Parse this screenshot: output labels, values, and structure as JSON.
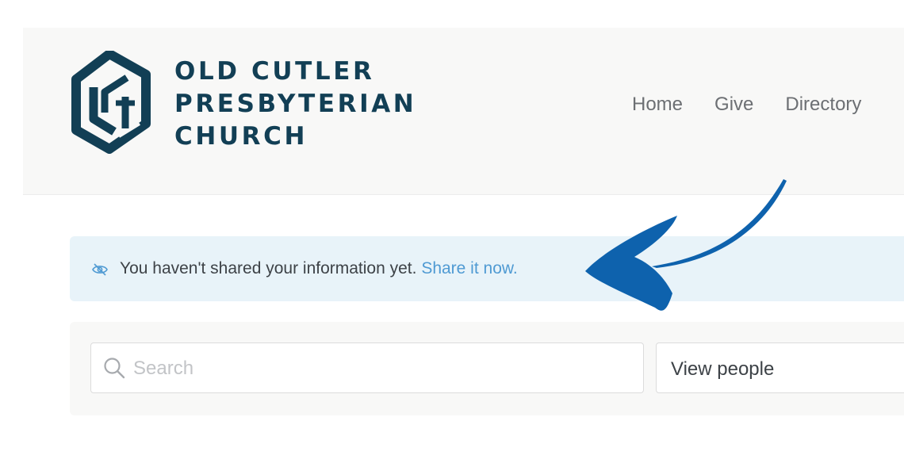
{
  "header": {
    "logo": {
      "line1": "OLD CUTLER",
      "line2": "PRESBYTERIAN",
      "line3": "CHURCH",
      "icon": "church-logo-icon",
      "color": "#123f55"
    },
    "nav": {
      "home": "Home",
      "give": "Give",
      "directory": "Directory"
    }
  },
  "banner": {
    "icon": "eye-slash-icon",
    "message": "You haven't shared your information yet.",
    "link": "Share it now.",
    "background": "#e8f3f9",
    "link_color": "#4f9ad3"
  },
  "toolbar": {
    "search": {
      "icon": "search-icon",
      "placeholder": "Search",
      "value": ""
    },
    "view_select": {
      "value": "View people"
    }
  },
  "annotation": {
    "icon": "arrow-pointer-icon",
    "color": "#0e62ad"
  }
}
